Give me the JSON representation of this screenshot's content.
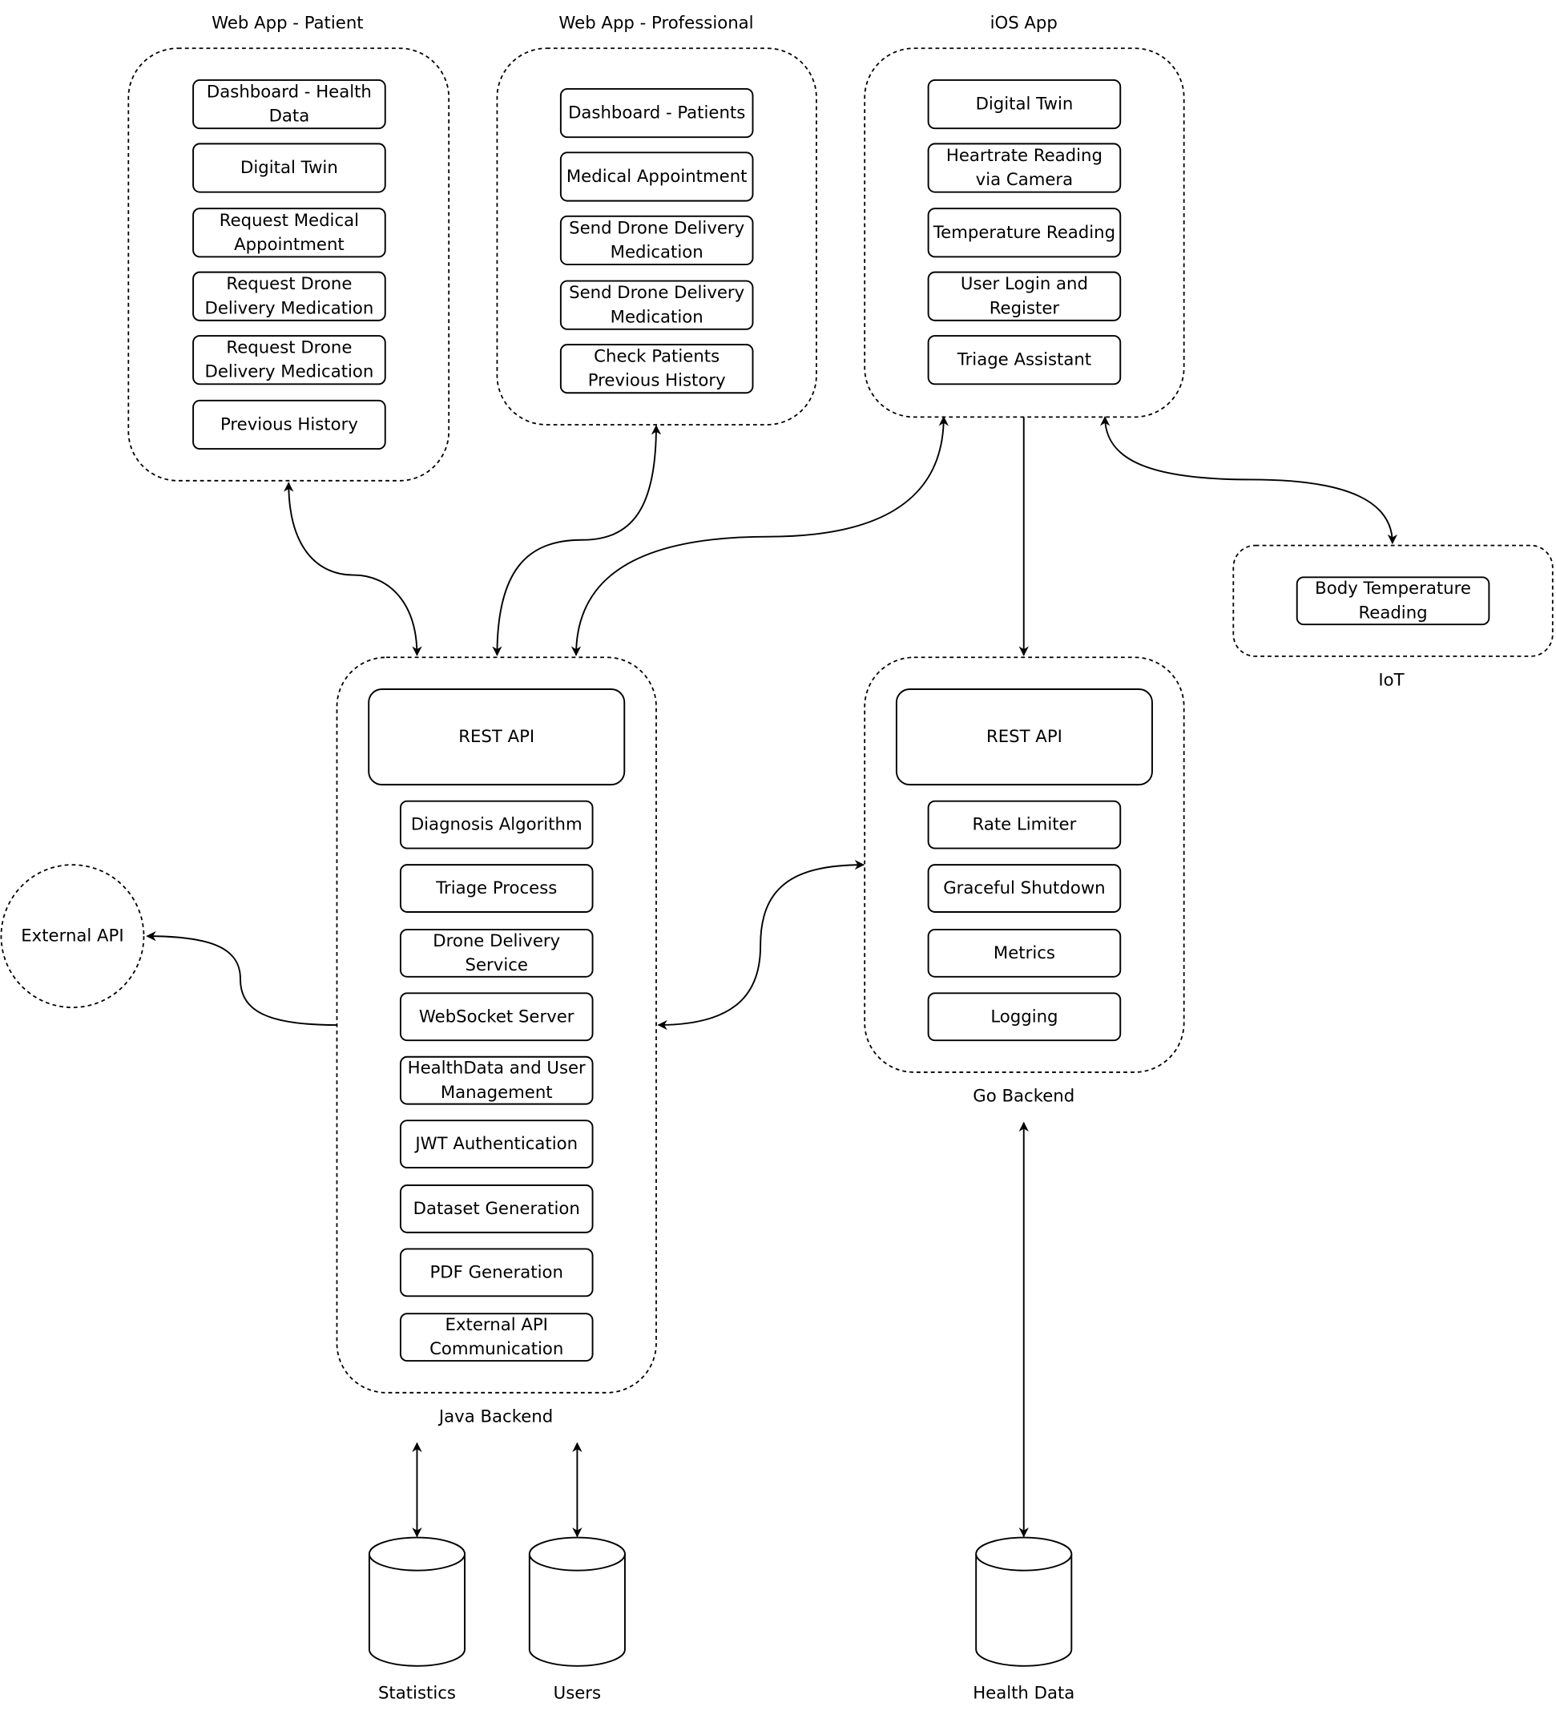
{
  "groups": {
    "patient": {
      "title": "Web App - Patient",
      "items": [
        [
          "Dashboard - Health",
          "Data"
        ],
        [
          "Digital Twin"
        ],
        [
          "Request Medical",
          "Appointment"
        ],
        [
          "Request Drone",
          "Delivery Medication"
        ],
        [
          "Request Drone",
          "Delivery Medication"
        ],
        [
          "Previous History"
        ]
      ]
    },
    "professional": {
      "title": "Web App - Professional",
      "items": [
        [
          "Dashboard - Patients"
        ],
        [
          "Medical Appointment"
        ],
        [
          "Send Drone Delivery",
          "Medication"
        ],
        [
          "Send Drone Delivery",
          "Medication"
        ],
        [
          "Check Patients",
          "Previous History"
        ]
      ]
    },
    "ios": {
      "title": "iOS App",
      "items": [
        [
          "Digital Twin"
        ],
        [
          "Heartrate Reading",
          "via Camera"
        ],
        [
          "Temperature Reading"
        ],
        [
          "User Login and",
          "Register"
        ],
        [
          "Triage Assistant"
        ]
      ]
    },
    "iot": {
      "title": "IoT",
      "items": [
        [
          "Body Temperature",
          "Reading"
        ]
      ]
    },
    "java": {
      "title": "Java Backend",
      "api": "REST API",
      "items": [
        [
          "Diagnosis Algorithm"
        ],
        [
          "Triage Process"
        ],
        [
          "Drone Delivery",
          "Service"
        ],
        [
          "WebSocket Server"
        ],
        [
          "HealthData and User",
          "Management"
        ],
        [
          "JWT Authentication"
        ],
        [
          "Dataset Generation"
        ],
        [
          "PDF Generation"
        ],
        [
          "External API",
          "Communication"
        ]
      ]
    },
    "go": {
      "title": "Go Backend",
      "api": "REST API",
      "items": [
        [
          "Rate Limiter"
        ],
        [
          "Graceful Shutdown"
        ],
        [
          "Metrics"
        ],
        [
          "Logging"
        ]
      ]
    }
  },
  "external_api": "External API",
  "databases": [
    "Statistics",
    "Users",
    "Health Data"
  ]
}
